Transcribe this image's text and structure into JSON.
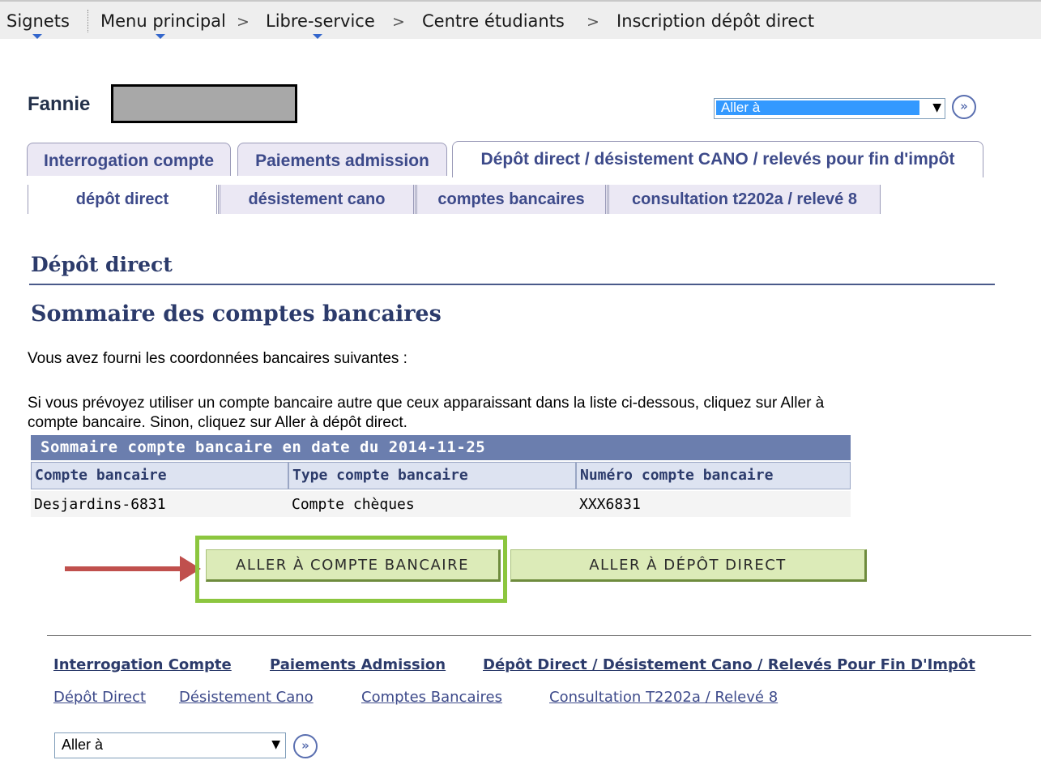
{
  "breadcrumb": {
    "items": [
      "Signets",
      "Menu principal",
      "Libre-service",
      "Centre étudiants",
      "Inscription dépôt direct"
    ],
    "separator": ">"
  },
  "user": {
    "first_name": "Fannie"
  },
  "goto_top": {
    "label": "Aller à",
    "go_icon": "»"
  },
  "tabs": [
    {
      "label": "Interrogation compte"
    },
    {
      "label": "Paiements admission"
    },
    {
      "label": "Dépôt direct / désistement CANO / relevés pour fin d'impôt"
    }
  ],
  "subtabs": [
    {
      "label": "dépôt direct"
    },
    {
      "label": "désistement cano"
    },
    {
      "label": "comptes bancaires"
    },
    {
      "label": "consultation t2202a / relevé 8"
    }
  ],
  "page": {
    "title": "Dépôt direct",
    "section_title": "Sommaire des comptes bancaires",
    "intro": "Vous avez fourni les coordonnées bancaires suivantes :",
    "instructions": "Si vous prévoyez utiliser un compte bancaire autre que ceux apparaissant dans la liste ci-dessous, cliquez sur Aller à compte bancaire. Sinon, cliquez sur Aller à dépôt direct."
  },
  "grid": {
    "title": "Sommaire compte bancaire en date du 2014-11-25",
    "columns": [
      "Compte bancaire",
      "Type compte bancaire",
      "Numéro compte bancaire"
    ],
    "rows": [
      [
        "Desjardins-6831",
        "Compte chèques",
        "XXX6831"
      ]
    ]
  },
  "buttons": {
    "account": "ALLER À COMPTE BANCAIRE",
    "deposit": "ALLER À DÉPÔT DIRECT"
  },
  "footer": {
    "links_row1": [
      "Interrogation Compte",
      "Paiements Admission",
      "Dépôt Direct / Désistement Cano / Relevés Pour Fin D'Impôt"
    ],
    "links_row2": [
      "Dépôt Direct",
      "Désistement Cano",
      "Comptes Bancaires",
      "Consultation T2202a / Relevé 8"
    ],
    "goto_label": "Aller à",
    "go_icon": "»"
  },
  "colors": {
    "tab_text": "#3d4a8a",
    "grid_header": "#6b7eae",
    "button_bg": "#dcebb8",
    "highlight_box": "#8cc63f",
    "annotation_arrow": "#c0504d"
  }
}
